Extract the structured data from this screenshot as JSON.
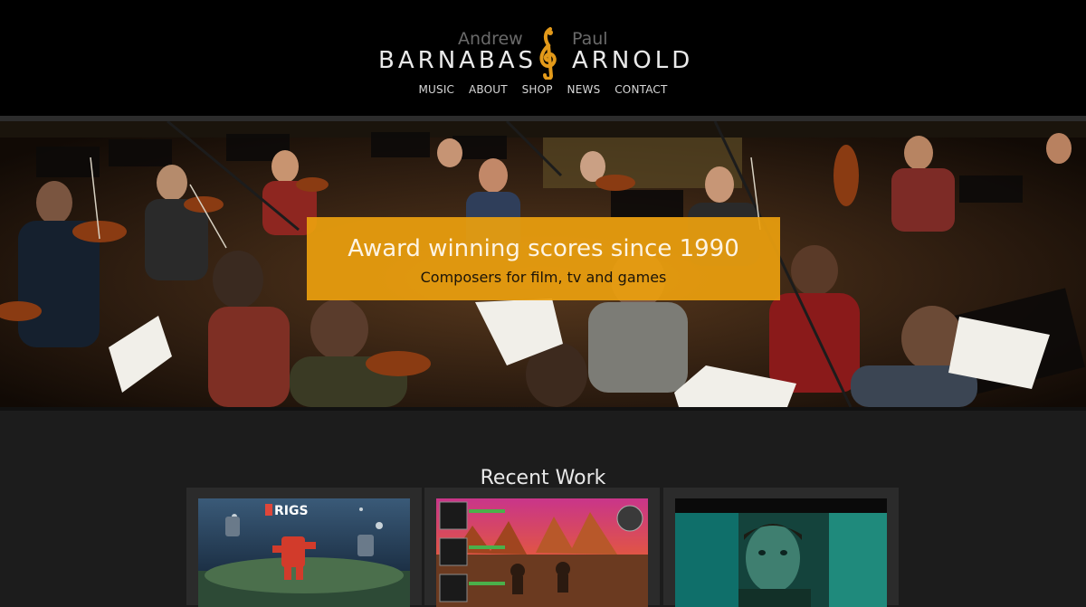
{
  "logo": {
    "first_left": "Andrew",
    "last_left": "BARNABAS",
    "first_right": "Paul",
    "last_right": "ARNOLD",
    "clef_icon": "treble-clef-icon",
    "accent": "#e39a1a"
  },
  "nav": {
    "items": [
      {
        "label": "MUSIC"
      },
      {
        "label": "ABOUT"
      },
      {
        "label": "SHOP"
      },
      {
        "label": "NEWS"
      },
      {
        "label": "CONTACT"
      }
    ]
  },
  "hero": {
    "title": "Award winning scores since 1990",
    "subtitle": "Composers for film, tv and games",
    "banner_color": "#eca00e"
  },
  "recent_work": {
    "title": "Recent Work",
    "cards": [
      {
        "thumb_caption": "RIGS"
      },
      {
        "thumb_caption": ""
      },
      {
        "thumb_caption": ""
      }
    ]
  }
}
